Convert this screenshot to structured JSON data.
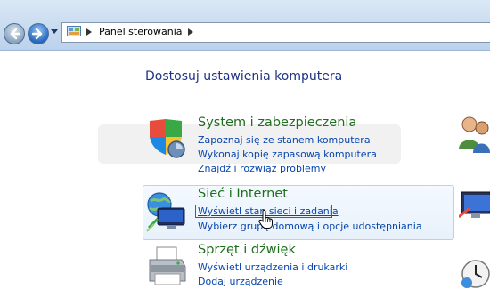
{
  "navbar": {
    "back_icon": "back-arrow-icon",
    "forward_icon": "forward-arrow-icon",
    "address": {
      "crumb": "Panel sterowania"
    }
  },
  "main": {
    "heading": "Dostosuj ustawienia komputera",
    "sections": [
      {
        "title": "System i zabezpieczenia",
        "icon": "shield-icon",
        "links": [
          "Zapoznaj się ze stanem komputera",
          "Wykonaj kopię zapasową komputera",
          "Znajdź i rozwiąż problemy"
        ]
      },
      {
        "title": "Sieć i Internet",
        "icon": "network-globe-icon",
        "links": [
          "Wyświetl stan sieci i zadania",
          "Wybierz grupę domową i opcje udostępniania"
        ]
      },
      {
        "title": "Sprzęt i dźwięk",
        "icon": "printer-icon",
        "links": [
          "Wyświetl urządzenia i drukarki",
          "Dodaj urządzenie"
        ]
      }
    ]
  },
  "colors": {
    "section_title": "#1e6e1e",
    "link": "#0645ad",
    "heading": "#1e3287",
    "highlight_box": "#d9242a"
  }
}
